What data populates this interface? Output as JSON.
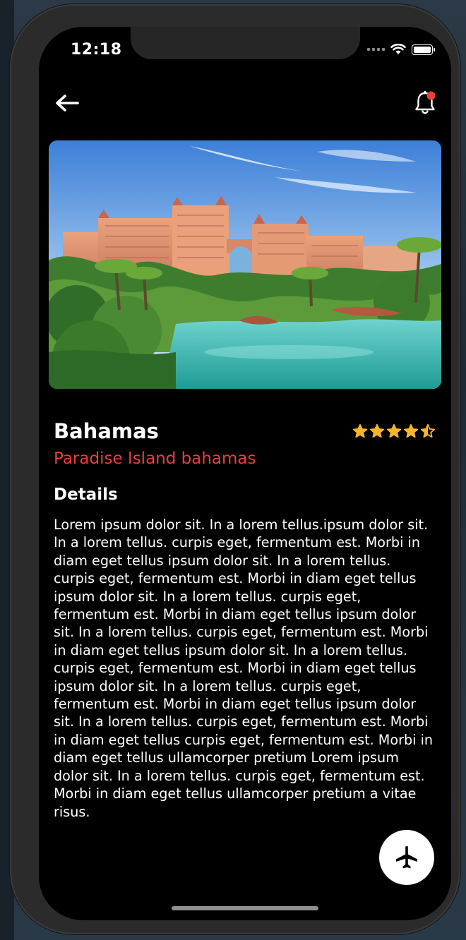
{
  "status_bar": {
    "time": "12:18"
  },
  "header": {
    "back_icon": "arrow-left-icon",
    "notification_icon": "bell-icon",
    "notification_dot_color": "#e6403a"
  },
  "hero_image": {
    "description_icon": "resort-photo"
  },
  "place": {
    "title": "Bahamas",
    "subtitle": "Paradise Island bahamas",
    "subtitle_color": "#e6403a",
    "rating": 4.5,
    "star_color": "#f5b52e"
  },
  "details": {
    "heading": "Details",
    "body": "Lorem ipsum dolor sit. In a lorem tellus.ipsum dolor sit. In a lorem tellus. curpis eget, fermentum est. Morbi in diam eget tellus  ipsum dolor sit. In a lorem tellus. curpis eget, fermentum est. Morbi in diam eget tellus ipsum dolor sit. In a lorem tellus. curpis eget, fermentum est. Morbi in diam eget tellus ipsum dolor sit. In a lorem tellus. curpis eget, fermentum est. Morbi in diam eget tellus ipsum dolor sit. In a lorem tellus. curpis eget, fermentum est. Morbi in diam eget tellus ipsum dolor sit. In a lorem tellus. curpis eget, fermentum est. Morbi in diam eget tellus ipsum dolor sit. In a lorem tellus. curpis eget, fermentum est. Morbi in diam eget tellus curpis eget, fermentum est. Morbi in diam eget tellus ullamcorper pretium Lorem ipsum dolor sit. In a lorem tellus. curpis eget, fermentum est. Morbi in diam eget tellus ullamcorper pretium a vitae risus."
  },
  "fab": {
    "icon": "airplane-icon"
  }
}
